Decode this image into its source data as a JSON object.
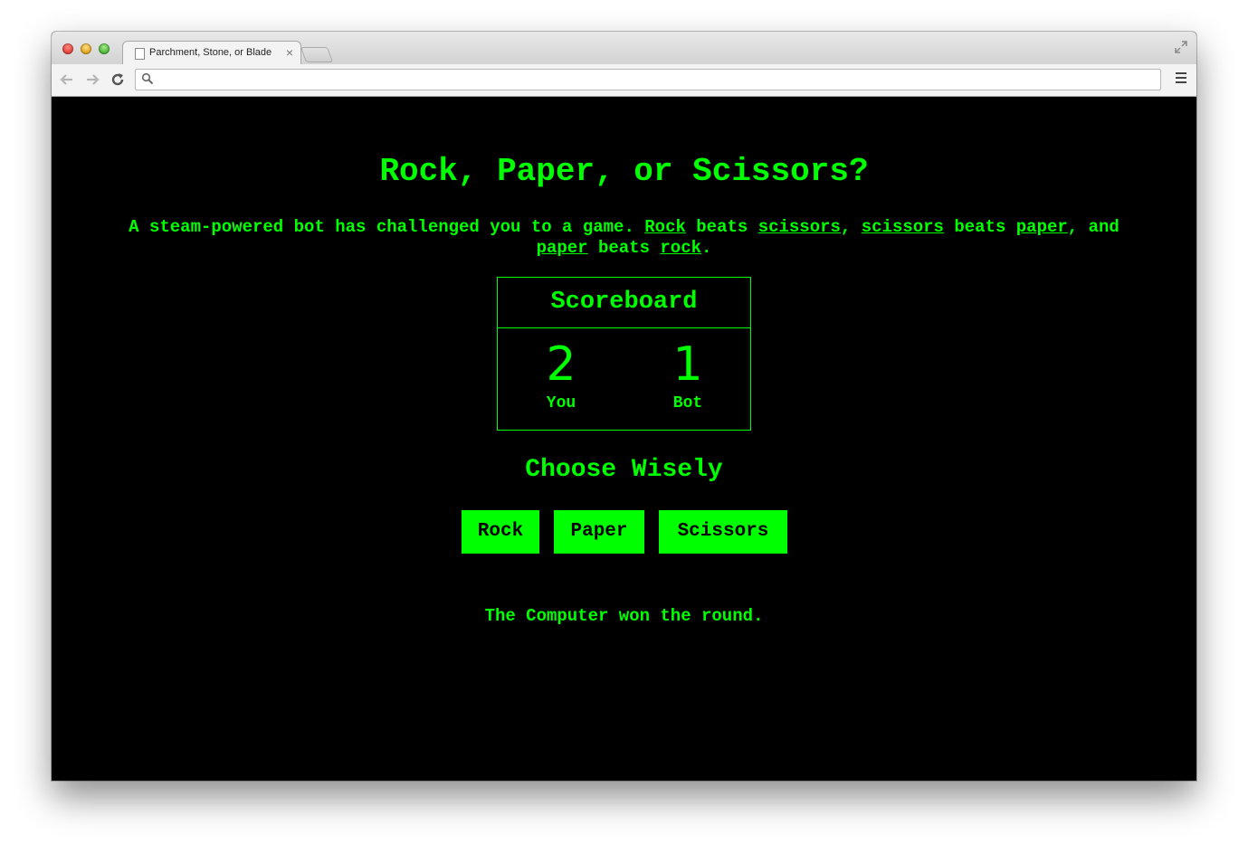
{
  "browser": {
    "tab_title": "Parchment, Stone, or Blade",
    "tab_close": "×",
    "address": ""
  },
  "page": {
    "heading": "Rock, Paper, or Scissors?",
    "intro": {
      "part1": "A steam-powered bot has challenged you to a game. ",
      "rock1": "Rock",
      "beats1": " beats ",
      "scissors1": "scissors",
      "comma1": ", ",
      "scissors2": "scissors",
      "beats2": " beats ",
      "paper1": "paper",
      "comma2": ", and ",
      "paper2": "paper",
      "beats3": " beats ",
      "rock2": "rock",
      "period": "."
    },
    "scoreboard": {
      "title": "Scoreboard",
      "you_score": "2",
      "you_label": "You",
      "bot_score": "1",
      "bot_label": "Bot"
    },
    "choose_heading": "Choose Wisely",
    "buttons": {
      "rock": "Rock",
      "paper": "Paper",
      "scissors": "Scissors"
    },
    "result": "The Computer won the round."
  },
  "colors": {
    "accent": "#00ff00",
    "background": "#000000"
  }
}
